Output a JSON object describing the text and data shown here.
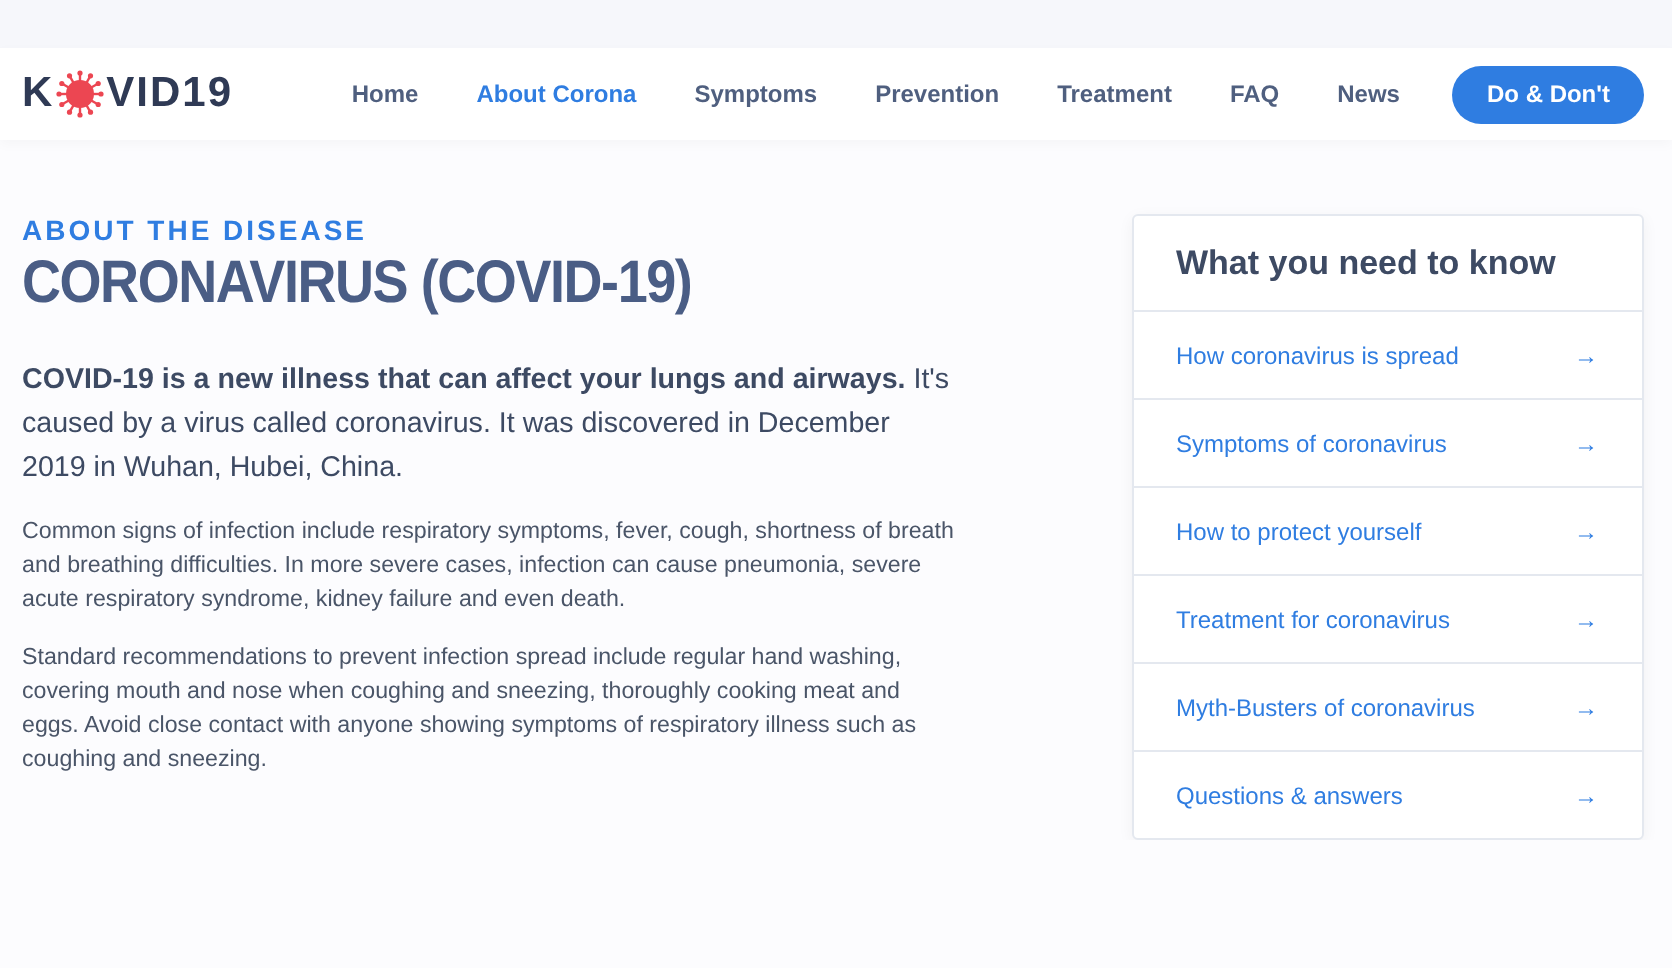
{
  "logo": {
    "before": "K",
    "after": "VID19"
  },
  "nav": [
    {
      "label": "Home",
      "selected": false
    },
    {
      "label": "About Corona",
      "selected": true
    },
    {
      "label": "Symptoms",
      "selected": false
    },
    {
      "label": "Prevention",
      "selected": false
    },
    {
      "label": "Treatment",
      "selected": false
    },
    {
      "label": "FAQ",
      "selected": false
    },
    {
      "label": "News",
      "selected": false
    }
  ],
  "cta": "Do & Don't",
  "eyebrow": "ABOUT THE DISEASE",
  "title": "CORONAVIRUS (COVID-19)",
  "lead": "**COVID-19 is a new illness that can affect your lungs and airways.** It's caused by a virus called coronavirus. It was discovered in December 2019 in Wuhan, Hubei, China.",
  "paragraphs": [
    "Common signs of infection include respiratory symptoms, fever, cough, shortness of breath and breathing difficulties. In more severe cases, infection can cause pneumonia, severe acute respiratory syndrome, kidney failure and even death.",
    "Standard recommendations to prevent infection spread include regular hand washing, covering mouth and nose when coughing and sneezing, thoroughly cooking meat and eggs. Avoid close contact with anyone showing symptoms of respiratory illness such as coughing and sneezing."
  ],
  "sidebar": {
    "title": "What you need to know",
    "items": [
      {
        "label": "How coronavirus is spread",
        "arrow": "→"
      },
      {
        "label": "Symptoms of coronavirus",
        "arrow": "→"
      },
      {
        "label": "How to protect yourself",
        "arrow": "→"
      },
      {
        "label": "Treatment for coronavirus",
        "arrow": "→"
      },
      {
        "label": "Myth-Busters of coronavirus",
        "arrow": "→"
      },
      {
        "label": "Questions & answers",
        "arrow": "→"
      }
    ]
  }
}
